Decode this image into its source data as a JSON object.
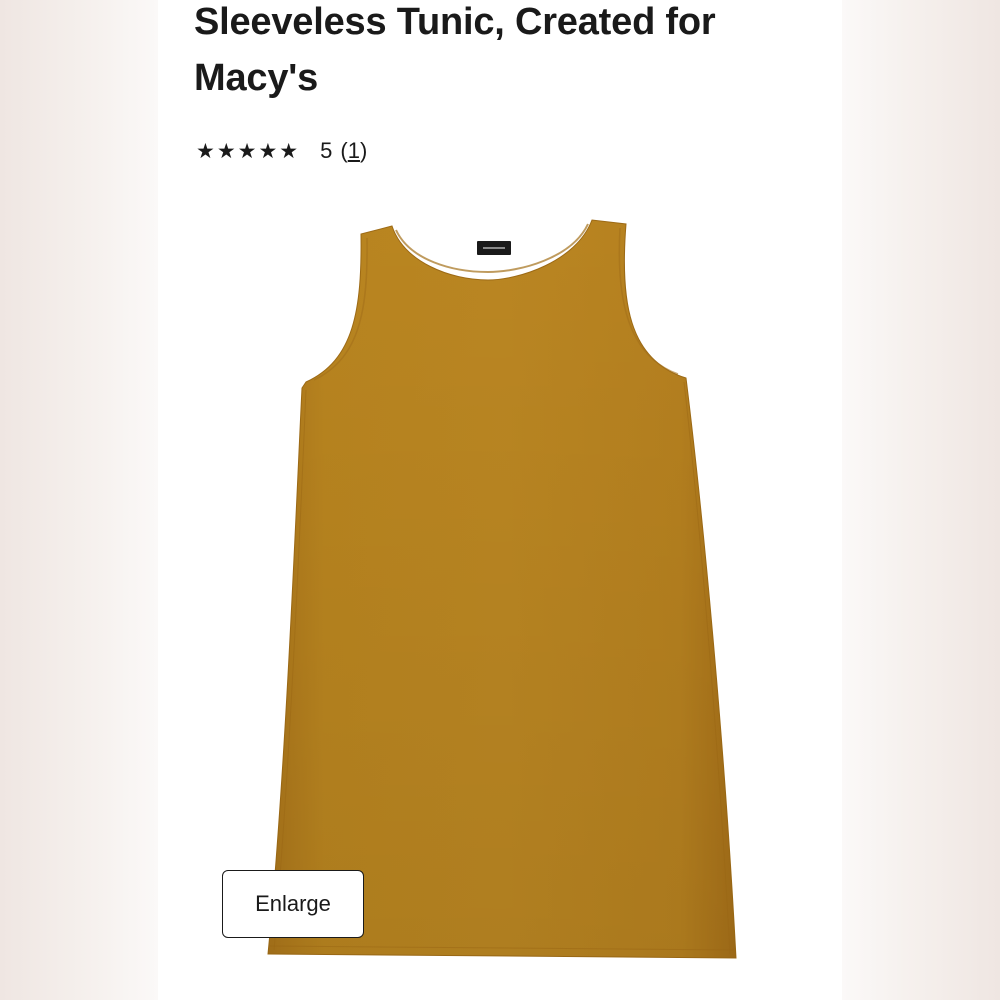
{
  "product": {
    "title": "Sleeveless Tunic, Created for Macy's",
    "rating": {
      "stars": "★★★★★",
      "score": "5",
      "open_paren": "(",
      "count": "1",
      "close_paren": ")"
    },
    "image": {
      "subject": "sleeveless tunic, mustard gold",
      "color": "#b5801f",
      "label_color": "#1a1a1a"
    },
    "enlarge_label": "Enlarge"
  },
  "colors": {
    "page_bg": "#ffffff",
    "text": "#1a1a1a",
    "side_bg": "#f2ece8"
  }
}
